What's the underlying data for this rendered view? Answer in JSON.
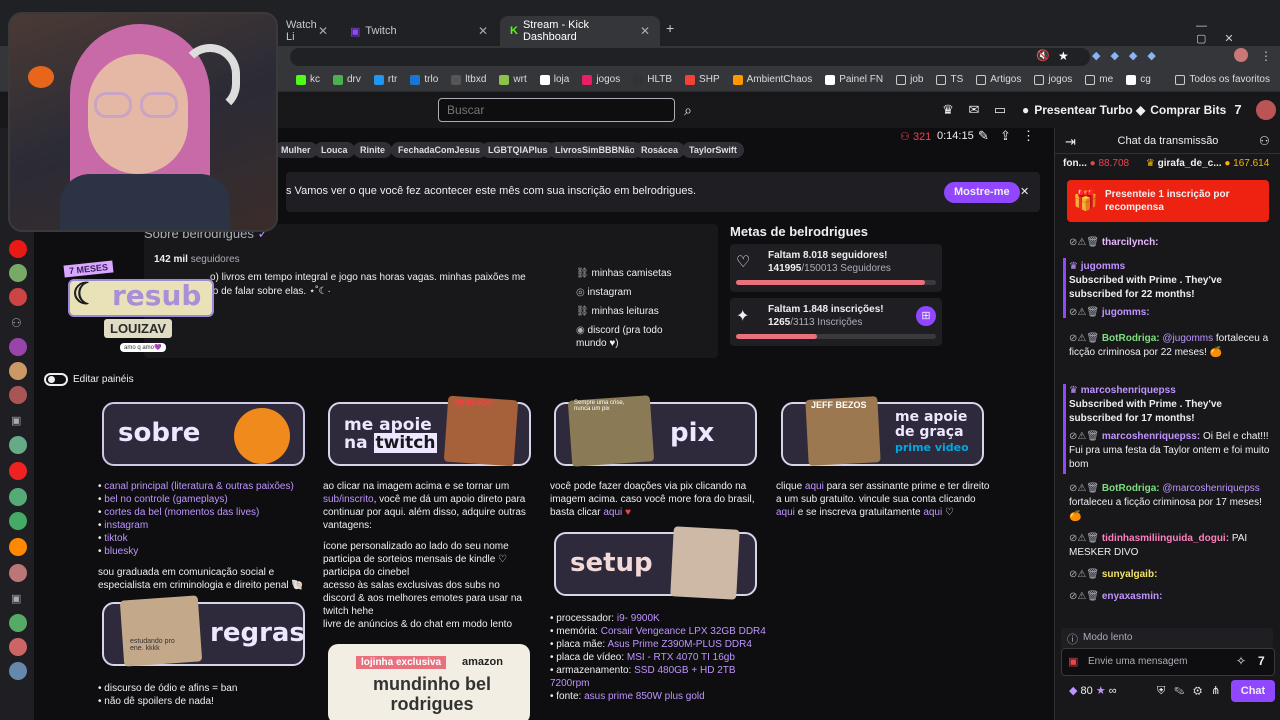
{
  "browser": {
    "tabs": [
      {
        "label": "Watch Li"
      },
      {
        "label": "Twitch"
      },
      {
        "label": "Stream - Kick Dashboard"
      }
    ],
    "new_tab": "+",
    "bookmarks": [
      "kc",
      "drv",
      "rtr",
      "trlo",
      "ltbxd",
      "wrt",
      "loja",
      "jogos",
      "HLTB",
      "SHP",
      "AmbientChaos",
      "Painel FN",
      "job",
      "TS",
      "Artigos",
      "jogos",
      "me",
      "cg"
    ],
    "all_bookmarks": "Todos os favoritos"
  },
  "topnav": {
    "search_placeholder": "Buscar",
    "turbo": "Presentear Turbo",
    "bits": "Comprar Bits"
  },
  "stream": {
    "viewers": "321",
    "uptime": "0:14:15",
    "tags": [
      "Mulher",
      "Louca",
      "Rinite",
      "FechadaComJesus",
      "LGBTQIAPlus",
      "LivrosSimBBBNão",
      "Rosácea",
      "TaylorSwift"
    ]
  },
  "banner": {
    "text": "s Vamos ver o que você fez acontecer este mês com sua inscrição em belrodrigues.",
    "button": "Mostre-me"
  },
  "about": {
    "title": "Sobre belrodrigues",
    "followers": "142 mil",
    "followers_label": "seguidores",
    "bio1": "o) livros em tempo integral e jogo nas horas vagas. minhas paixões me",
    "bio2": "to de falar sobre elas. ⋆˚☾·",
    "links": [
      "minhas camisetas",
      "instagram",
      "minhas leituras",
      "discord (pra todo mundo ♥)"
    ]
  },
  "badge": {
    "months": "7 MESES",
    "resub": "resub",
    "name": "LOUIZAV",
    "tagline": "amo q amo💜"
  },
  "goals": {
    "title": "Metas de belrodrigues",
    "g1_title": "Faltam 8.018 seguidores!",
    "g1_count": "141995",
    "g1_total": "/150013 Seguidores",
    "g1_progress": 0.9466,
    "g2_title": "Faltam 1.848 inscrições!",
    "g2_count": "1265",
    "g2_total": "/3113 Inscrições",
    "g2_progress": 0.4064
  },
  "edit_panels": "Editar painéis",
  "panels": {
    "sobre": {
      "title": "sobre",
      "links": [
        "canal principal (literatura & outras paixões)",
        "bel no controle (gameplays)",
        "cortes da bel (momentos das lives)",
        "instagram",
        "tiktok",
        "bluesky"
      ],
      "desc": "sou graduada em comunicação social e especialista em criminologia e direito penal 🐚"
    },
    "apoie": {
      "line1": "me apoie",
      "line2": "na",
      "line3": "twitch",
      "sticker": "OBRIGADO!",
      "p1": "ao clicar na imagem acima e se tornar um",
      "p1link": "sub/inscrito",
      "p2": ", você me dá um apoio direto para continuar por aqui. além disso, adquire outras vantagens:",
      "bullets": [
        "ícone personalizado ao lado do seu nome",
        "participa de sorteios mensais de kindle ♡",
        "participa do cinebel",
        "acesso às salas exclusivas dos subs no discord & aos melhores emotes para usar na twitch hehe",
        "livre de anúncios & do chat em modo lento"
      ]
    },
    "pix": {
      "title": "pix",
      "sticker": "Sempre uma crise, nunca um pix",
      "text": "você pode fazer doações via pix clicando na imagem acima. caso você more fora do brasil, basta clicar",
      "link": "aqui"
    },
    "prime": {
      "line1": "me apoie",
      "line2": "de graça",
      "line3": "prime video",
      "sticker": "JEFF BEZOS",
      "t1": "clique",
      "link1": "aqui",
      "t2": "para ser assinante prime e ter direito a um sub gratuito. vincule sua conta clicando",
      "link2": "aqui",
      "t3": "e se inscreva gratuitamente",
      "link3": "aqui",
      "t4": "♡"
    },
    "regras": {
      "title": "regras",
      "sticker": "estudando pro ene. kkkk",
      "bullets": [
        "discurso de ódio e afins = ban",
        "não dê spoilers de nada!"
      ]
    },
    "setup": {
      "title": "setup",
      "items": [
        {
          "label": "processador:",
          "value": "i9- 9900K"
        },
        {
          "label": "memória:",
          "value": "Corsair Vengeance LPX 32GB DDR4"
        },
        {
          "label": "placa mãe:",
          "value": "Asus Prime Z390M-PLUS DDR4"
        },
        {
          "label": "placa de vídeo:",
          "value": "MSI - RTX 4070 TI 16gb"
        },
        {
          "label": "armazenamento:",
          "value": "SSD 480GB + HD 2TB 7200rpm"
        },
        {
          "label": "fonte:",
          "value": "asus prime 850W plus gold"
        }
      ]
    },
    "lojinha": {
      "label": "lojinha exclusiva",
      "brand": "amazon",
      "title": "mundinho bel rodrigues"
    }
  },
  "chat": {
    "title": "Chat da transmissão",
    "leader1_name": "fon...",
    "leader1_points": "88.708",
    "leader2_name": "girafa_de_c...",
    "leader2_points": "167.614",
    "gift": "Presenteie 1 inscrição por recompensa",
    "messages": [
      {
        "user": "tharcilynch:",
        "text": ""
      },
      {
        "type": "sub",
        "user": "jugomms",
        "text": "Subscribed with Prime . They've subscribed for",
        "months": "22 months",
        "end": "!"
      },
      {
        "user": "jugomms:",
        "text": ""
      },
      {
        "user": "BotRodriga:",
        "mention": "@jugomms",
        "text": "fortaleceu a ficção criminosa por 22 meses! 🍊"
      },
      {
        "type": "sub",
        "user": "marcoshenriquepss",
        "text": "Subscribed with Prime . They've subscribed for",
        "months": "17 months",
        "end": "!"
      },
      {
        "user": "marcoshenriquepss:",
        "text": "Oi Bel e chat!!! Fui pra uma festa da Taylor ontem e foi muito bom"
      },
      {
        "user": "BotRodriga:",
        "mention": "@marcoshenriquepss",
        "text": "fortaleceu a ficção criminosa por 17 meses! 🍊"
      },
      {
        "user": "tidinhasmiliinguida_dogui:",
        "text": "PAI MESKER DIVO"
      },
      {
        "user": "sunyalgaib:",
        "text": ""
      },
      {
        "user": "enyaxasmin:",
        "text": ""
      }
    ],
    "slow_mode": "Modo lento",
    "input_placeholder": "Envie uma mensagem",
    "points": "80",
    "send": "Chat"
  },
  "colors": {
    "accent": "#9147ff",
    "bg": "#0e0e10",
    "panel": "#18181b"
  }
}
